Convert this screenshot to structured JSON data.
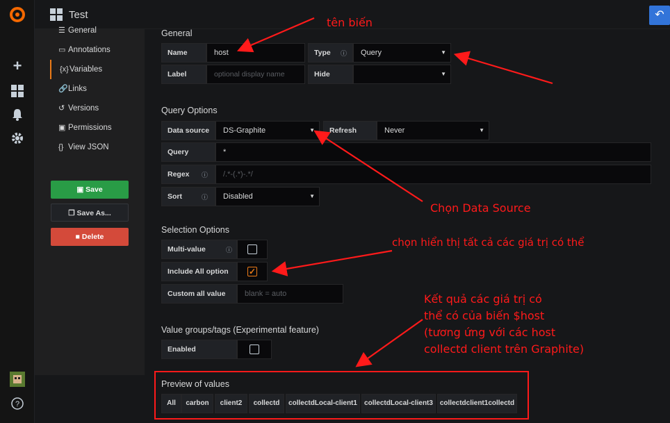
{
  "topbar": {
    "dashboard_title": "Test"
  },
  "sidenav": {
    "items": [
      {
        "label": "General",
        "icon": "sliders-icon"
      },
      {
        "label": "Annotations",
        "icon": "comment-icon"
      },
      {
        "label": "Variables",
        "icon": "variable-icon"
      },
      {
        "label": "Links",
        "icon": "link-icon"
      },
      {
        "label": "Versions",
        "icon": "history-icon"
      },
      {
        "label": "Permissions",
        "icon": "lock-icon"
      },
      {
        "label": "View JSON",
        "icon": "code-icon"
      }
    ],
    "active": "Variables",
    "save_label": "Save",
    "save_as_label": "Save As...",
    "delete_label": "Delete"
  },
  "general": {
    "title": "General",
    "name_label": "Name",
    "name_value": "host",
    "type_label": "Type",
    "type_value": "Query",
    "label_label": "Label",
    "label_placeholder": "optional display name",
    "hide_label": "Hide",
    "hide_value": ""
  },
  "query_options": {
    "title": "Query Options",
    "datasource_label": "Data source",
    "datasource_value": "DS-Graphite",
    "refresh_label": "Refresh",
    "refresh_value": "Never",
    "query_label": "Query",
    "query_value": "*",
    "regex_label": "Regex",
    "regex_placeholder": "/.*-(.*)-.*/",
    "sort_label": "Sort",
    "sort_value": "Disabled"
  },
  "selection_options": {
    "title": "Selection Options",
    "multi_label": "Multi-value",
    "multi_checked": false,
    "include_all_label": "Include All option",
    "include_all_checked": true,
    "custom_all_label": "Custom all value",
    "custom_all_placeholder": "blank = auto"
  },
  "value_groups": {
    "title": "Value groups/tags (Experimental feature)",
    "enabled_label": "Enabled",
    "enabled_checked": false
  },
  "preview": {
    "title": "Preview of values",
    "values": [
      "All",
      "carbon",
      "client2",
      "collectd",
      "collectdLocal-client1",
      "collectdLocal-client3",
      "collectdclient1collectd"
    ]
  },
  "annotations": {
    "var_name": "tên biến",
    "choose_ds": "Chọn Data Source",
    "show_all": "chọn hiển thị tất cả các giá trị có thể",
    "result_1": "Kết quả các giá trị có",
    "result_2": "thể có của biến $host",
    "result_3": "(tương ứng với các host",
    "result_4": "collectd client trên Graphite)"
  },
  "colors": {
    "accent": "#eb7b18",
    "save": "#299c46",
    "delete": "#d44a3a",
    "annotation": "#ff1a1a"
  }
}
